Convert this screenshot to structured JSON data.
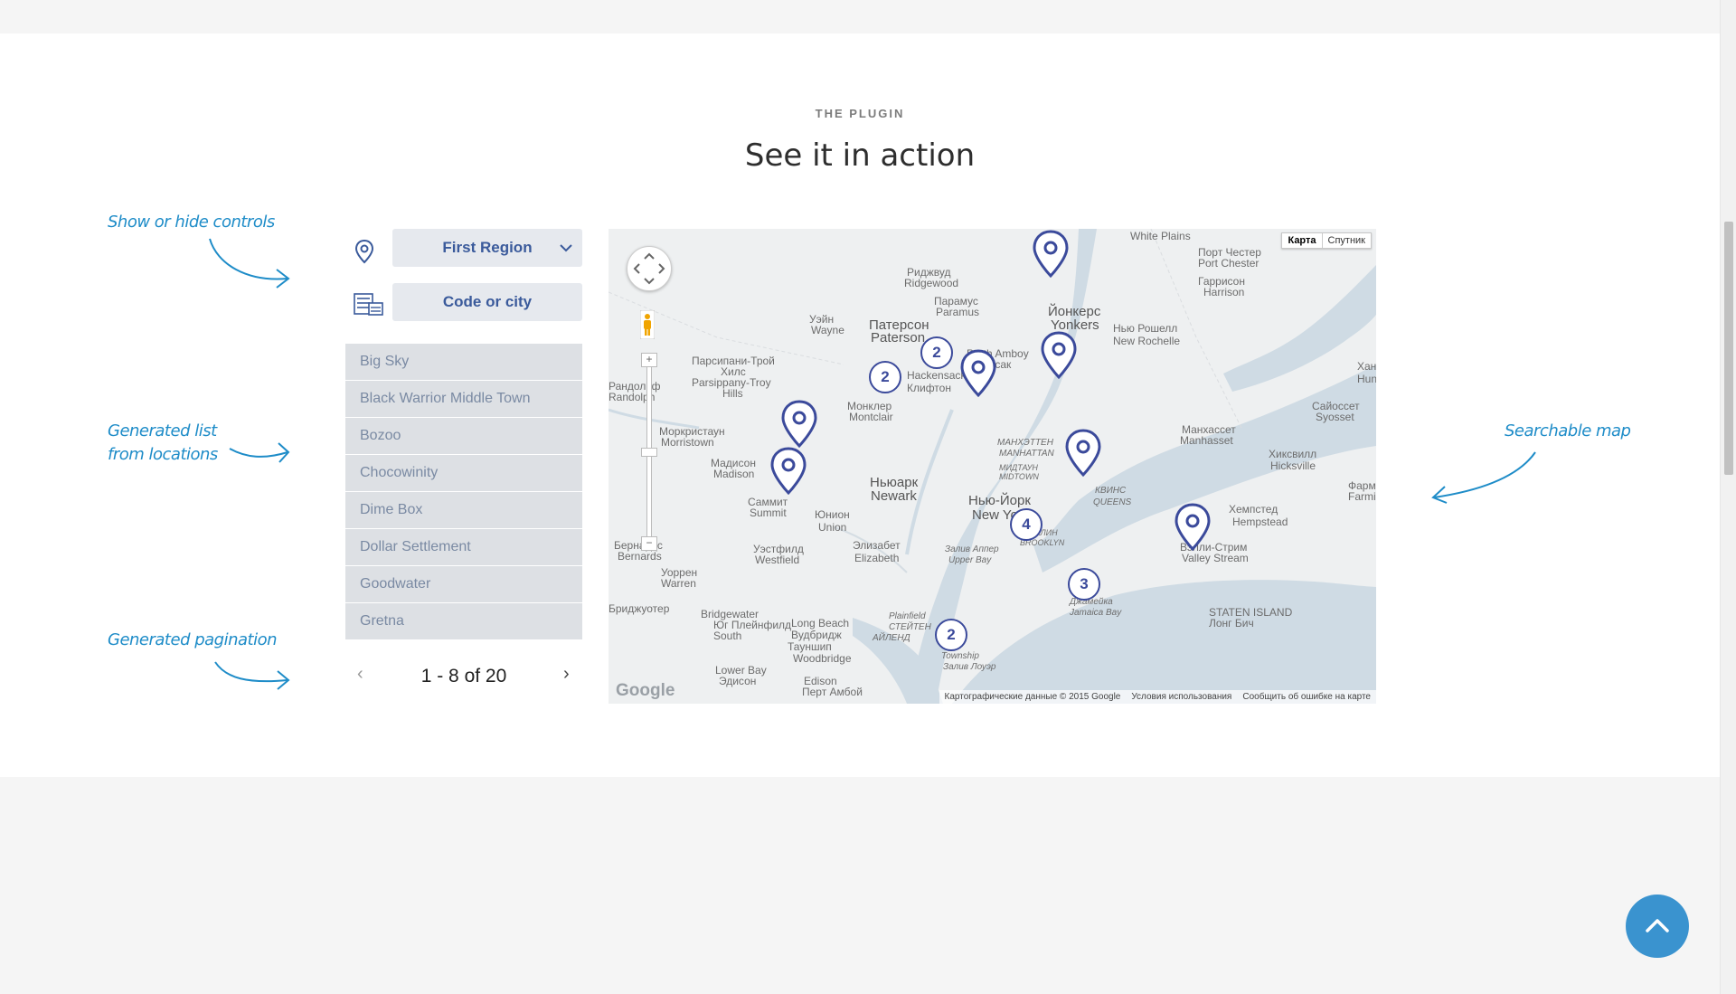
{
  "header": {
    "eyebrow": "THE PLUGIN",
    "title": "See it in action"
  },
  "annotations": {
    "controls": "Show or hide controls",
    "list_line1": "Generated list",
    "list_line2": "from locations",
    "pagination": "Generated pagination",
    "map": "Searchable map"
  },
  "controls": {
    "region_select": {
      "value": "First Region",
      "icon": "location-pin-icon"
    },
    "search": {
      "placeholder": "Code or city",
      "icon": "list-grid-icon"
    }
  },
  "locations": [
    "Big Sky",
    "Black Warrior Middle Town",
    "Bozoo",
    "Chocowinity",
    "Dime Box",
    "Dollar Settlement",
    "Goodwater",
    "Gretna"
  ],
  "pagination": {
    "text": "1 - 8 of 20",
    "prev": "‹",
    "next": "›"
  },
  "map": {
    "type_controls": {
      "map": "Карта",
      "satellite": "Спутник"
    },
    "attribution": {
      "data": "Картографические данные © 2015 Google",
      "terms": "Условия использования",
      "report": "Сообщить об ошибке на карте"
    },
    "logo": "Google",
    "zoom_in": "+",
    "zoom_out": "−",
    "labels": [
      "White Plains",
      "Порт Честер",
      "Port Chester",
      "Риджвуд",
      "Ridgewood",
      "Гаррисон",
      "Harrison",
      "Парамус",
      "Paramus",
      "Уэйн",
      "Wayne",
      "Патерсон",
      "Paterson",
      "Йонкерс",
      "Yonkers",
      "Нью Рошелл",
      "New Rochelle",
      "Парсипани-Трой",
      "Хилс",
      "Parsippany-Troy",
      "Hills",
      "Рандольф",
      "Randolph",
      "Хан",
      "Hun",
      "Сайоссет",
      "Syosset",
      "Моркристаун",
      "Morristown",
      "Монклер",
      "Montclair",
      "МАНХЭТТЕН",
      "MANHATTAN",
      "Манхассет",
      "Manhasset",
      "Хиксвилл",
      "Hicksville",
      "Мадисон",
      "Madison",
      "Ньюарк",
      "Newark",
      "МИДТАУН",
      "MIDTOWN",
      "КВИНС",
      "QUEENS",
      "Фармин",
      "Farmin",
      "Саммит",
      "Summit",
      "Нью-Йорк",
      "New York",
      "Хемпстед",
      "Hempstead",
      "Юнион",
      "Union",
      "БРУКЛИН",
      "BROOKLYN",
      "Элизабет",
      "Elizabeth",
      "Бернардс",
      "Bernards",
      "Уэстфилд",
      "Westfield",
      "Залив Аппер",
      "Upper Bay",
      "Вэлли-Стрим",
      "Valley Stream",
      "Уоррен",
      "Warren",
      "Джамейка",
      "Jamaica Bay",
      "Бриджуотер",
      "Bridgewater",
      "Юг Плейнфилд",
      "South",
      "Plainfield",
      "СТЕЙТЕН",
      "АЙЛЕНД",
      "STATEN ISLAND",
      "Лонг Бич",
      "Long Beach",
      "Вудбридж",
      "Тауншип",
      "Woodbridge",
      "Township",
      "Залив Лоуэр",
      "Lower Bay",
      "Эдисон",
      "Edison",
      "Перт Амбой",
      "Perth Amboy",
      "Хакенсак",
      "Hackensack",
      "Клифтон",
      "Clifton"
    ],
    "clusters": [
      "2",
      "2",
      "4",
      "3",
      "2"
    ]
  },
  "colors": {
    "accent": "#1e8cc8",
    "marker": "#3b4a9b",
    "select_text": "#3a5a9b",
    "list_bg": "#dde0e4",
    "to_top": "#3a93cf"
  },
  "icons": {
    "to_top": "chevron-up-icon",
    "marker": "map-marker-icon"
  }
}
